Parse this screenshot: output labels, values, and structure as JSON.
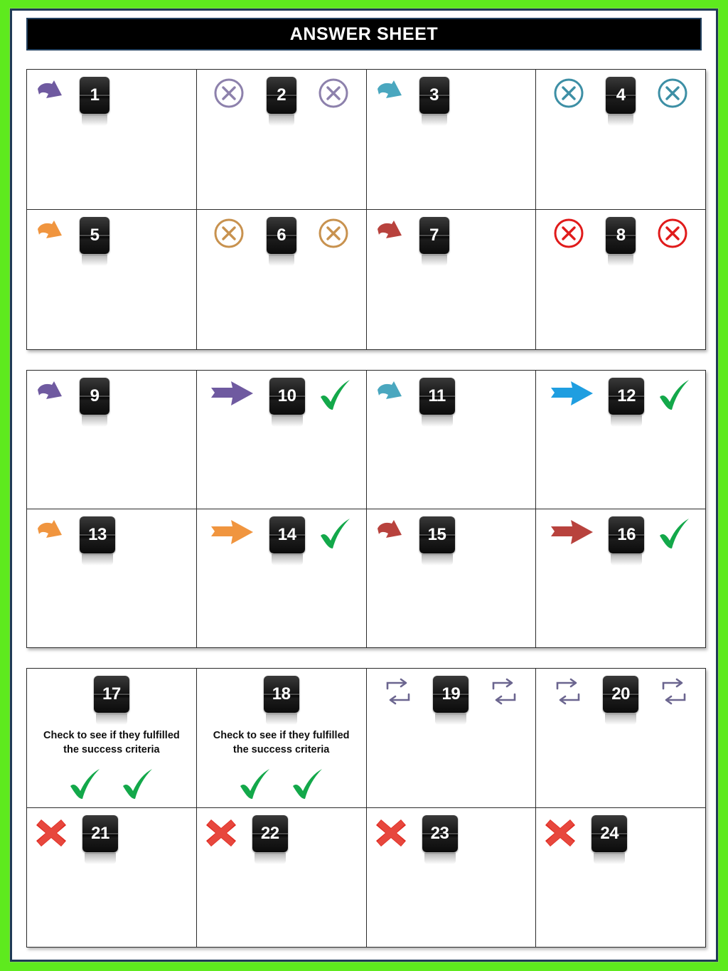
{
  "document": {
    "title": "ANSWER SHEET",
    "border_color": "#5eea1e",
    "frame_border_color": "#1f3a56",
    "title_bar_bg": "#000000",
    "title_bar_text_color": "#ffffff"
  },
  "palette": {
    "purple": "#6f5aa0",
    "purple_light": "#8d81ac",
    "teal": "#4aa7bf",
    "teal_dark": "#3d8fa5",
    "blue": "#1f9ee0",
    "orange": "#f0953f",
    "orange_dark": "#c8924f",
    "brick": "#b8423d",
    "red": "#e01b1b",
    "green_check": "#13a84a",
    "red_x": "#e02b22",
    "cycle_arrow": "#6b658f"
  },
  "tables": [
    {
      "name": "table-one",
      "rows": [
        [
          {
            "number": "1",
            "layout": "icon-left",
            "icons": [
              {
                "type": "bent-arrow-down-right",
                "color": "#6f5aa0"
              }
            ],
            "text": ""
          },
          {
            "number": "2",
            "layout": "flank",
            "icons": [
              {
                "type": "circle-x",
                "color": "#8d81ac"
              },
              {
                "type": "circle-x",
                "color": "#8d81ac"
              }
            ],
            "text": ""
          },
          {
            "number": "3",
            "layout": "icon-left",
            "icons": [
              {
                "type": "bent-arrow-down-right",
                "color": "#4aa7bf"
              }
            ],
            "text": ""
          },
          {
            "number": "4",
            "layout": "flank",
            "icons": [
              {
                "type": "circle-x",
                "color": "#3d8fa5"
              },
              {
                "type": "circle-x",
                "color": "#3d8fa5"
              }
            ],
            "text": ""
          }
        ],
        [
          {
            "number": "5",
            "layout": "icon-left",
            "icons": [
              {
                "type": "bent-arrow-down-right",
                "color": "#f0953f"
              }
            ],
            "text": ""
          },
          {
            "number": "6",
            "layout": "flank",
            "icons": [
              {
                "type": "circle-x",
                "color": "#c8924f"
              },
              {
                "type": "circle-x",
                "color": "#c8924f"
              }
            ],
            "text": ""
          },
          {
            "number": "7",
            "layout": "icon-left",
            "icons": [
              {
                "type": "bent-arrow-down-right",
                "color": "#b8423d"
              }
            ],
            "text": ""
          },
          {
            "number": "8",
            "layout": "flank",
            "icons": [
              {
                "type": "circle-x",
                "color": "#e01b1b"
              },
              {
                "type": "circle-x",
                "color": "#e01b1b"
              }
            ],
            "text": ""
          }
        ]
      ]
    },
    {
      "name": "table-two",
      "rows": [
        [
          {
            "number": "9",
            "layout": "icon-left",
            "icons": [
              {
                "type": "bent-arrow-down-right",
                "color": "#6f5aa0"
              }
            ],
            "text": ""
          },
          {
            "number": "10",
            "layout": "icon-left-check-right",
            "icons": [
              {
                "type": "straight-arrow-right",
                "color": "#6f5aa0"
              },
              {
                "type": "check",
                "color": "#13a84a"
              }
            ],
            "text": ""
          },
          {
            "number": "11",
            "layout": "icon-left",
            "icons": [
              {
                "type": "bent-arrow-down-right",
                "color": "#4aa7bf"
              }
            ],
            "text": ""
          },
          {
            "number": "12",
            "layout": "icon-left-check-right",
            "icons": [
              {
                "type": "straight-arrow-right",
                "color": "#1f9ee0"
              },
              {
                "type": "check",
                "color": "#13a84a"
              }
            ],
            "text": ""
          }
        ],
        [
          {
            "number": "13",
            "layout": "icon-left",
            "icons": [
              {
                "type": "bent-arrow-down-right",
                "color": "#f0953f"
              }
            ],
            "text": ""
          },
          {
            "number": "14",
            "layout": "icon-left-check-right",
            "icons": [
              {
                "type": "straight-arrow-right",
                "color": "#f0953f"
              },
              {
                "type": "check",
                "color": "#13a84a"
              }
            ],
            "text": ""
          },
          {
            "number": "15",
            "layout": "icon-left",
            "icons": [
              {
                "type": "bent-arrow-down-right",
                "color": "#b8423d"
              }
            ],
            "text": ""
          },
          {
            "number": "16",
            "layout": "icon-left-check-right",
            "icons": [
              {
                "type": "straight-arrow-right",
                "color": "#b8423d"
              },
              {
                "type": "check",
                "color": "#13a84a"
              }
            ],
            "text": ""
          }
        ]
      ]
    },
    {
      "name": "table-three",
      "rows": [
        [
          {
            "number": "17",
            "layout": "centered-text-checks",
            "icons": [
              {
                "type": "check",
                "color": "#13a84a"
              },
              {
                "type": "check",
                "color": "#13a84a"
              }
            ],
            "text": "Check to see if they fulfilled the success criteria"
          },
          {
            "number": "18",
            "layout": "centered-text-checks",
            "icons": [
              {
                "type": "check",
                "color": "#13a84a"
              },
              {
                "type": "check",
                "color": "#13a84a"
              }
            ],
            "text": "Check to see if they fulfilled the success criteria"
          },
          {
            "number": "19",
            "layout": "flank",
            "icons": [
              {
                "type": "cycle-arrow",
                "color": "#6b658f"
              },
              {
                "type": "cycle-arrow",
                "color": "#6b658f"
              }
            ],
            "text": ""
          },
          {
            "number": "20",
            "layout": "flank",
            "icons": [
              {
                "type": "cycle-arrow",
                "color": "#6b658f"
              },
              {
                "type": "cycle-arrow",
                "color": "#6b658f"
              }
            ],
            "text": ""
          }
        ],
        [
          {
            "number": "21",
            "layout": "icon-left",
            "icons": [
              {
                "type": "red-x",
                "color": "#e02b22"
              }
            ],
            "text": ""
          },
          {
            "number": "22",
            "layout": "icon-left",
            "icons": [
              {
                "type": "red-x",
                "color": "#e02b22"
              }
            ],
            "text": ""
          },
          {
            "number": "23",
            "layout": "icon-left",
            "icons": [
              {
                "type": "red-x",
                "color": "#e02b22"
              }
            ],
            "text": ""
          },
          {
            "number": "24",
            "layout": "icon-left",
            "icons": [
              {
                "type": "red-x",
                "color": "#e02b22"
              }
            ],
            "text": ""
          }
        ]
      ]
    }
  ]
}
